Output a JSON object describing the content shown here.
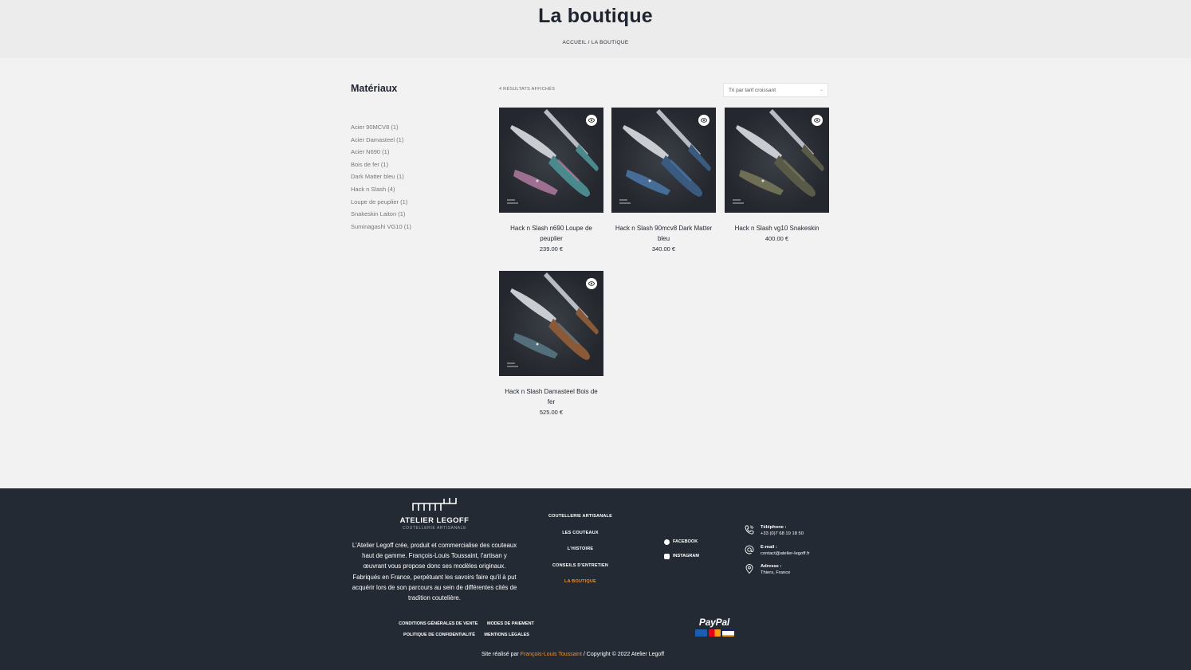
{
  "header": {
    "title": "La boutique",
    "breadcrumb_home": "ACCUEIL",
    "breadcrumb_sep": " / ",
    "breadcrumb_current": "LA BOUTIQUE"
  },
  "sidebar": {
    "title": "Matériaux",
    "filters": [
      "Acier 90MCV8 (1)",
      "Acier Damasteel (1)",
      "Acier N690 (1)",
      "Bois de fer (1)",
      "Dark Matter bleu (1)",
      "Hack n Slash (4)",
      "Loupe de peuplier (1)",
      "Snakeskin Laiton (1)",
      "Suminagashi VG10 (1)"
    ]
  },
  "results": {
    "count_label": "4 RÉSULTATS AFFICHÉS",
    "sort_label": "Tri par tarif croissant"
  },
  "products": [
    {
      "name": "Hack n Slash n690 Loupe de peuplier",
      "price": "239.00 €",
      "handle_color": "#4a8a8e",
      "accent": "#b07aa0"
    },
    {
      "name": "Hack n Slash 90mcv8 Dark Matter bleu",
      "price": "340.00 €",
      "handle_color": "#3a5a80",
      "accent": "#4a78a8"
    },
    {
      "name": "Hack n Slash vg10 Snakeskin",
      "price": "400.00 €",
      "handle_color": "#5a5a48",
      "accent": "#7a7a5a"
    },
    {
      "name": "Hack n Slash Damasteel Bois de fer",
      "price": "525.00 €",
      "handle_color": "#8a5a38",
      "accent": "#5a7a88"
    }
  ],
  "footer": {
    "brand": "ATELIER LEGOFF",
    "brand_sub": "COUTELLERIE ARTISANALE",
    "about": "L'Atelier Legoff crée, produit et commercialise des couteaux haut de gamme. François-Louis Toussaint, l'artisan y œuvrant vous propose donc ses modèles originaux. Fabriqués en France, perpétuant les savoirs faire qu'il à put acquérir lors de son parcours au sein de différentes cités de tradition coutelière.",
    "nav": [
      "COUTELLERIE ARTISANALE",
      "LES COUTEAUX",
      "L'HISTOIRE",
      "CONSEILS D'ENTRETIEN",
      "LA BOUTIQUE"
    ],
    "social": [
      "FACEBOOK",
      "INSTAGRAM"
    ],
    "contact": {
      "phone_label": "Téléphone :",
      "phone": "+33 (0)7 68 19 18 50",
      "email_label": "E-mail :",
      "email": "contact@atelier-legoff.fr",
      "address_label": "Adresse :",
      "address": "Thiers, France"
    },
    "legal_row1": [
      "CONDITIONS GÉNÉRALES DE VENTE",
      "MODES DE PAIEMENT"
    ],
    "legal_row2": [
      "POLITIQUE DE CONFIDENTIALITÉ",
      "MENTIONS LÉGALES"
    ],
    "paypal": "PayPal",
    "credit_prefix": "Site réalisé par ",
    "credit_author": "François-Louis Toussaint",
    "credit_suffix": " / Copyright © 2022 Atelier Legoff"
  },
  "colors": {
    "accent": "#e8913a",
    "footer_bg": "#232a33",
    "header_bg": "#ececec"
  }
}
